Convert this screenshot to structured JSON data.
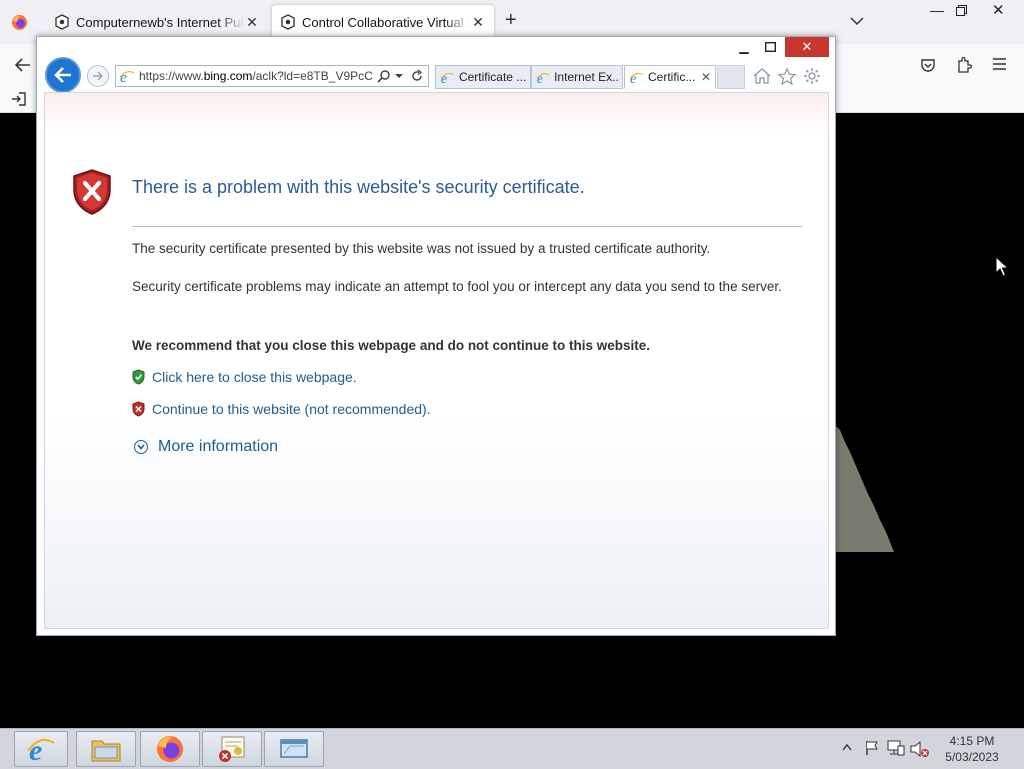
{
  "firefox": {
    "tabs": [
      {
        "label": "Computernewb's Internet Pub H"
      },
      {
        "label": "Control Collaborative Virtual M"
      }
    ],
    "new_tab_symbol": "+",
    "bookmarks_item_icon": "import-icon"
  },
  "ie": {
    "address": {
      "prefix": "https://www.",
      "domain": "bing.com",
      "suffix": "/aclk?ld=e8TB_V9PcC"
    },
    "tabs": [
      {
        "label": "Certificate ..."
      },
      {
        "label": "Internet Ex..."
      },
      {
        "label": "Certific..."
      }
    ],
    "page": {
      "title": "There is a problem with this website's security certificate.",
      "p1": "The security certificate presented by this website was not issued by a trusted certificate authority.",
      "p2": "Security certificate problems may indicate an attempt to fool you or intercept any data you send to the server.",
      "recommend": "We recommend that you close this webpage and do not continue to this website.",
      "close_link": "Click here to close this webpage.",
      "continue_link": "Continue to this website (not recommended).",
      "more_info": "More information"
    }
  },
  "taskbar": {
    "time": "4:15 PM",
    "date": "5/03/2023"
  },
  "colors": {
    "ie_accent": "#1f74d1",
    "title_blue": "#2d5a94",
    "link_blue": "#1e5d8f",
    "close_red": "#c7372f"
  }
}
